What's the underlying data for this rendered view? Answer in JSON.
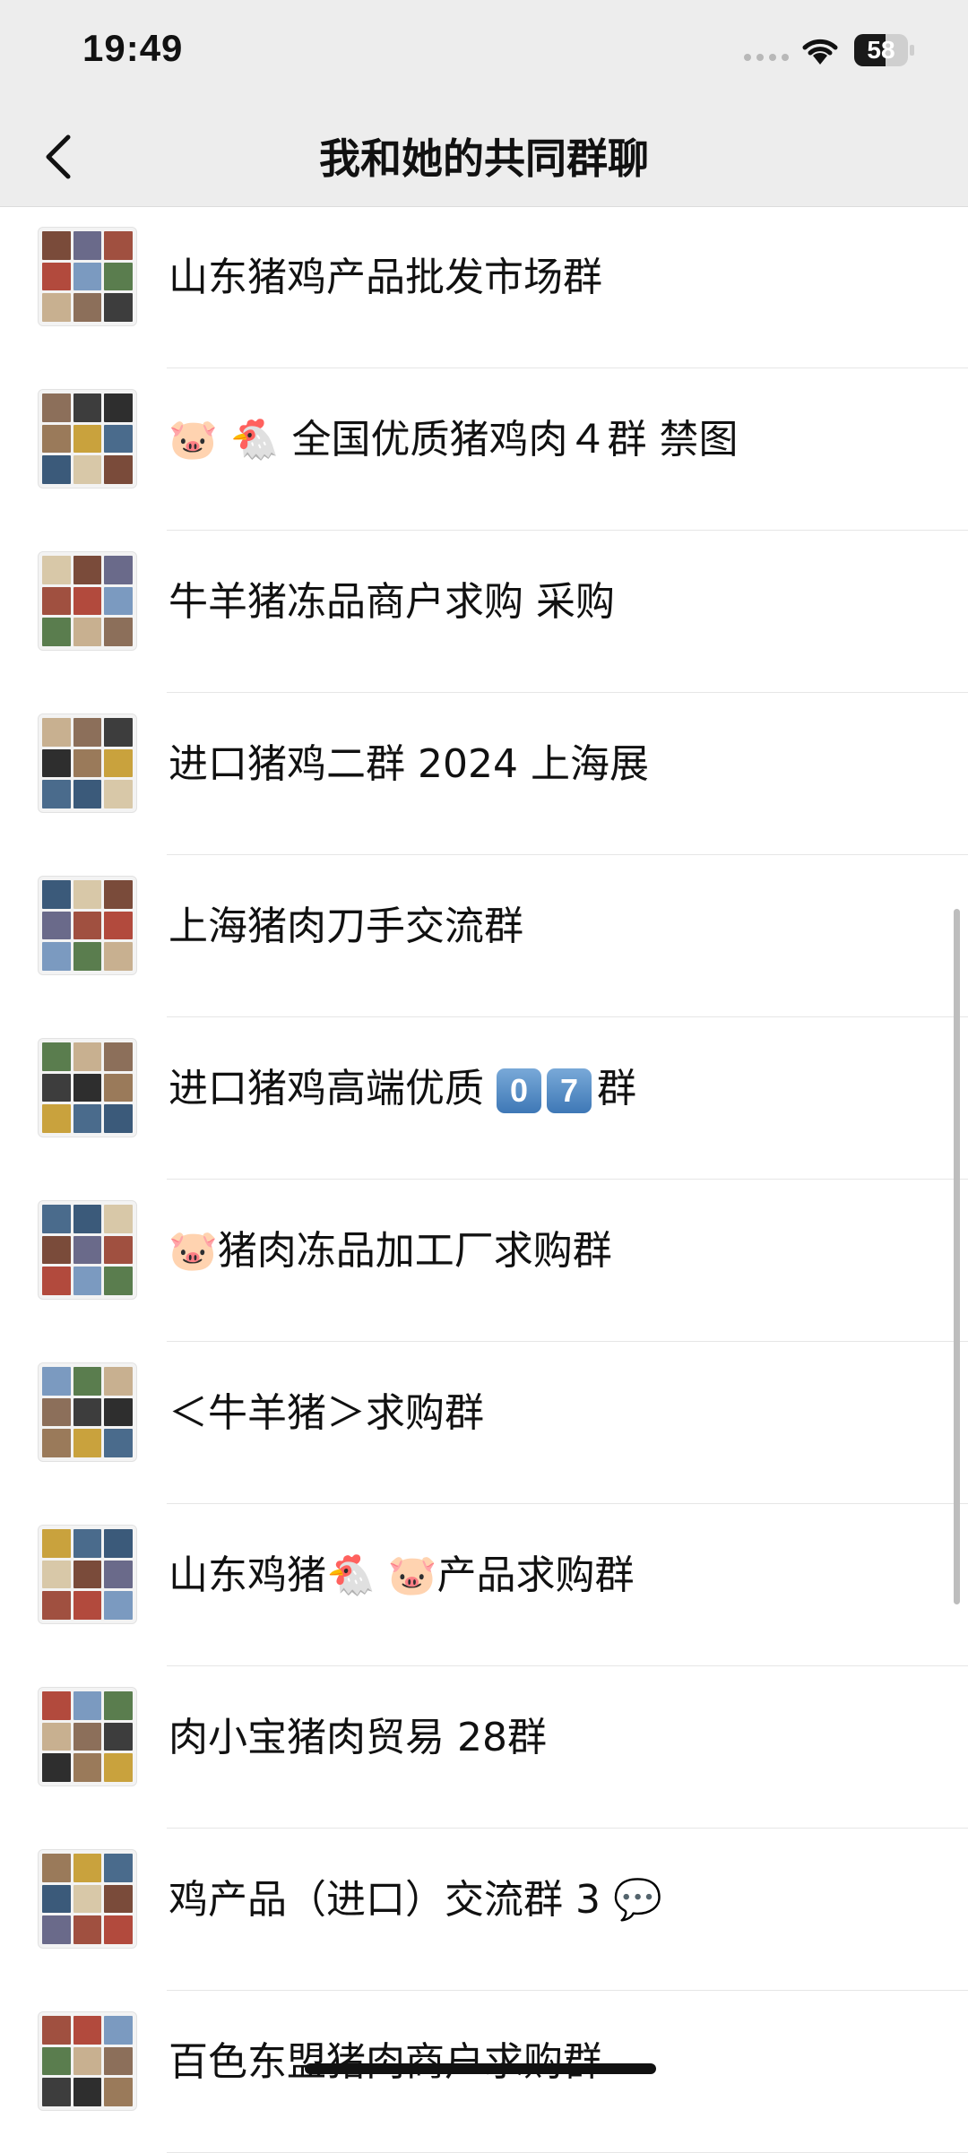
{
  "status_bar": {
    "time": "19:49",
    "battery_level": "58",
    "battery_fraction": 0.58
  },
  "nav": {
    "title": "我和她的共同群聊",
    "back_icon": "chevron-left-icon"
  },
  "groups": [
    {
      "name": "山东猪鸡产品批发市场群"
    },
    {
      "name": "🐷 🐔 全国优质猪鸡肉４群 禁图"
    },
    {
      "name": "牛羊猪冻品商户求购 采购"
    },
    {
      "name": "进口猪鸡二群 2024 上海展"
    },
    {
      "name": "上海猪肉刀手交流群"
    },
    {
      "name": "进口猪鸡高端优质",
      "keycaps": [
        "0",
        "7"
      ],
      "suffix": "群"
    },
    {
      "name": "🐷猪肉冻品加工厂求购群"
    },
    {
      "name": "＜牛羊猪＞求购群"
    },
    {
      "name": "山东鸡猪🐔 🐷产品求购群"
    },
    {
      "name": "肉小宝猪肉贸易 28群"
    },
    {
      "name": "鸡产品（进口）交流群 3 💬"
    },
    {
      "name": "百色东盟猪肉商户求购群"
    }
  ],
  "colors": {
    "header_bg": "#ededed",
    "text": "#111111",
    "divider": "#e6e6e6"
  }
}
